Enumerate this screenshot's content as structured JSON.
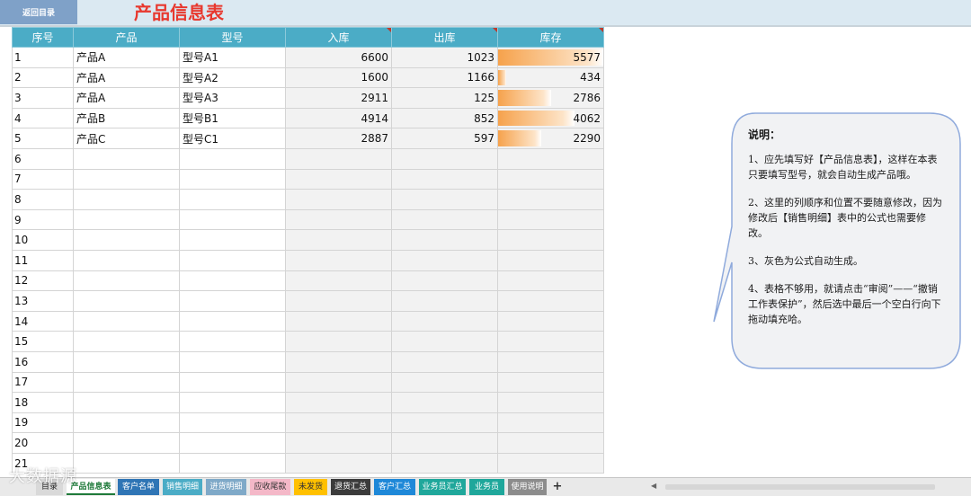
{
  "banner": {
    "back_button": "返回目录",
    "title": "产品信息表"
  },
  "table": {
    "headers": [
      "序号",
      "产品",
      "型号",
      "入库",
      "出库",
      "库存"
    ],
    "rows": [
      {
        "idx": "1",
        "product": "产品A",
        "model": "型号A1",
        "in": "6600",
        "out": "1023",
        "stock": "5577",
        "stock_fraction": 1.0
      },
      {
        "idx": "2",
        "product": "产品A",
        "model": "型号A2",
        "in": "1600",
        "out": "1166",
        "stock": "434",
        "stock_fraction": 0.08
      },
      {
        "idx": "3",
        "product": "产品A",
        "model": "型号A3",
        "in": "2911",
        "out": "125",
        "stock": "2786",
        "stock_fraction": 0.5
      },
      {
        "idx": "4",
        "product": "产品B",
        "model": "型号B1",
        "in": "4914",
        "out": "852",
        "stock": "4062",
        "stock_fraction": 0.73
      },
      {
        "idx": "5",
        "product": "产品C",
        "model": "型号C1",
        "in": "2887",
        "out": "597",
        "stock": "2290",
        "stock_fraction": 0.41
      }
    ],
    "empty_rows": [
      "6",
      "7",
      "8",
      "9",
      "10",
      "11",
      "12",
      "13",
      "14",
      "15",
      "16",
      "17",
      "18",
      "19",
      "20",
      "21"
    ]
  },
  "note": {
    "title": "说明：",
    "paragraphs": [
      "1、应先填写好【产品信息表】，这样在本表只要填写型号，就会自动生成产品哦。",
      "2、这里的列顺序和位置不要随意修改，因为修改后【销售明细】表中的公式也需要修改。",
      "3、灰色为公式自动生成。",
      "4、表格不够用，就请点击“审阅”——“撤销工作表保护”，然后选中最后一个空白行向下拖动填充哈。"
    ]
  },
  "tabs": [
    {
      "label": "目录",
      "color": "#d9d9d9",
      "text_color": "#222"
    },
    {
      "label": "产品信息表",
      "color": "#ffffff",
      "text_color": "#1f7a3a"
    },
    {
      "label": "客户名单",
      "color": "#2f75b5",
      "text_color": "#ffffff"
    },
    {
      "label": "销售明细",
      "color": "#4bacc6",
      "text_color": "#ffffff"
    },
    {
      "label": "进货明细",
      "color": "#7fa9c8",
      "text_color": "#ffffff"
    },
    {
      "label": "应收尾款",
      "color": "#f4b8c8",
      "text_color": "#333"
    },
    {
      "label": "未发货",
      "color": "#ffc000",
      "text_color": "#333"
    },
    {
      "label": "退货汇总",
      "color": "#3b3b3b",
      "text_color": "#ffffff"
    },
    {
      "label": "客户汇总",
      "color": "#1e88d8",
      "text_color": "#ffffff"
    },
    {
      "label": "业务员汇总",
      "color": "#1fa79b",
      "text_color": "#ffffff"
    },
    {
      "label": "业务员",
      "color": "#1fa79b",
      "text_color": "#ffffff"
    },
    {
      "label": "使用说明",
      "color": "#8c8c8c",
      "text_color": "#ffffff"
    }
  ],
  "add_sheet": "+",
  "watermark": "大数据源"
}
